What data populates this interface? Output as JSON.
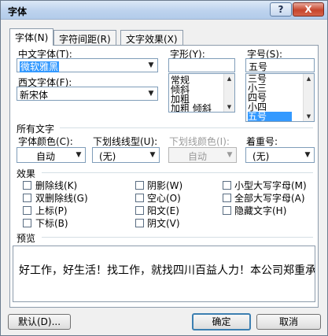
{
  "window": {
    "title": "字体",
    "help": "?",
    "close": "X"
  },
  "tabs": [
    {
      "label": "字体(N)"
    },
    {
      "label": "字符间距(R)"
    },
    {
      "label": "文字效果(X)"
    }
  ],
  "chinese_font": {
    "label": "中文字体(T):",
    "value": "微软雅黑"
  },
  "western_font": {
    "label": "西文字体(F):",
    "value": "新宋体"
  },
  "style": {
    "label": "字形(Y):",
    "value": "",
    "options": [
      "常规",
      "倾斜",
      "加粗",
      "加粗 倾斜"
    ]
  },
  "size": {
    "label": "字号(S):",
    "value": "五号",
    "options": [
      "三号",
      "小三",
      "四号",
      "小四",
      "五号"
    ],
    "selected": "五号"
  },
  "all_text": {
    "heading": "所有文字"
  },
  "font_color": {
    "label": "字体颜色(C):",
    "value": "自动"
  },
  "underline_style": {
    "label": "下划线线型(U):",
    "value": "(无)"
  },
  "underline_color": {
    "label": "下划线颜色(I):",
    "value": "自动"
  },
  "emphasis": {
    "label": "着重号:",
    "value": "(无)"
  },
  "effects": {
    "heading": "效果",
    "col1": [
      "删除线(K)",
      "双删除线(G)",
      "上标(P)",
      "下标(B)"
    ],
    "col2": [
      "阴影(W)",
      "空心(O)",
      "阳文(E)",
      "阴文(V)"
    ],
    "col3": [
      "小型大写字母(M)",
      "全部大写字母(A)",
      "隐藏文字(H)"
    ]
  },
  "preview": {
    "heading": "预览",
    "text": "好工作，好生活！找工作，就找四川百益人力！本公司郑重承"
  },
  "buttons": {
    "default": "默认(D)...",
    "ok": "确定",
    "cancel": "取消"
  }
}
